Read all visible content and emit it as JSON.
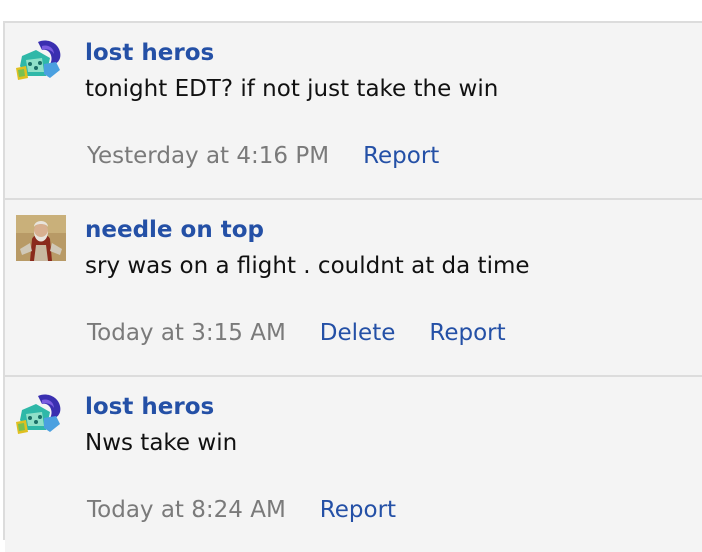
{
  "posts": [
    {
      "author": "lost heros",
      "avatar_icon": "lion-mascot-icon",
      "body": "tonight EDT? if not just take the win",
      "timestamp": "Yesterday at 4:16 PM",
      "actions": [
        "Report"
      ]
    },
    {
      "author": "needle on top",
      "avatar_icon": "painting-portrait-icon",
      "body": "sry was on a flight . couldnt at da time",
      "timestamp": "Today at 3:15 AM",
      "actions": [
        "Delete",
        "Report"
      ]
    },
    {
      "author": "lost heros",
      "avatar_icon": "lion-mascot-icon",
      "body": "Nws take win",
      "timestamp": "Today at 8:24 AM",
      "actions": [
        "Report"
      ]
    }
  ],
  "colors": {
    "link": "#2450a6",
    "timestamp": "#7a7a7a",
    "background": "#f4f4f4",
    "divider": "#dcdcdc"
  }
}
